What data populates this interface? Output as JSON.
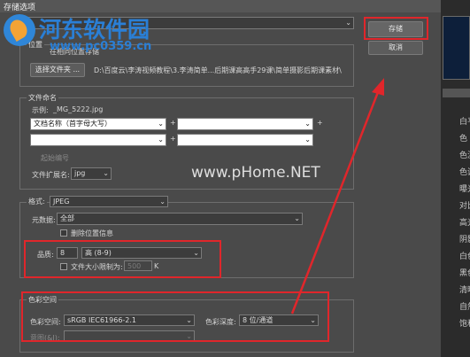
{
  "window_title": "存储选项",
  "buttons": {
    "save": "存储",
    "cancel": "取消"
  },
  "logo": {
    "title": "河东软件园",
    "url": "www.pc0359.cn"
  },
  "watermark": "www.pHome.NET",
  "location": {
    "title": "位置",
    "radio_label": "在相同位置存储",
    "choose_folder_button": "选择文件夹 ...",
    "folder_path": "D:\\百度云\\李涛视频教程\\3.李涛简单...后期课高高手29课\\简单摄影后期课素材\\"
  },
  "naming": {
    "title": "文件命名",
    "example_label": "示例:",
    "example_value": "_MG_5222.jpg",
    "field1": "文档名称（首字母大写）",
    "start_number_label": "起始编号",
    "extension_label": "文件扩展名:",
    "extension_value": "jpg"
  },
  "format": {
    "title": "格式:",
    "value": "JPEG",
    "metadata_label": "元数据:",
    "metadata_value": "全部",
    "remove_location_label": "删除位置信息",
    "quality_label": "品质:",
    "quality_value": "8",
    "quality_level": "高 (8-9)",
    "limit_size_label": "文件大小限制为:",
    "limit_size_value": "500",
    "limit_size_unit": "K"
  },
  "color_space": {
    "title": "色彩空间",
    "space_label": "色彩空间:",
    "space_value": "sRGB IEC61966-2.1",
    "depth_label": "色彩深度:",
    "depth_value": "8 位/通道",
    "intent_label": "意图(&I):"
  },
  "right_panel": [
    "白平",
    "色",
    "色温",
    "色调",
    "曝光",
    "对比",
    "高光",
    "阴影",
    "白色",
    "黑色",
    "清晰",
    "自然",
    "饱和"
  ],
  "highlight_color": "#e0262b"
}
